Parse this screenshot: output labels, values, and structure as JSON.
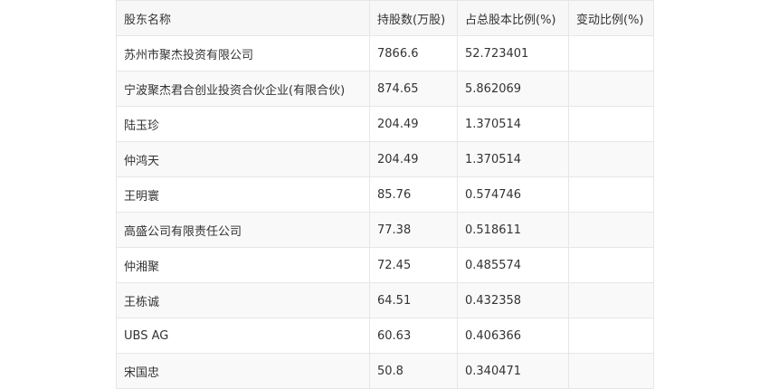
{
  "table": {
    "headers": [
      "股东名称",
      "持股数(万股)",
      "占总股本比例(%)",
      "变动比例(%)"
    ],
    "rows": [
      [
        "苏州市聚杰投资有限公司",
        "7866.6",
        "52.723401",
        ""
      ],
      [
        "宁波聚杰君合创业投资合伙企业(有限合伙)",
        "874.65",
        "5.862069",
        ""
      ],
      [
        "陆玉珍",
        "204.49",
        "1.370514",
        ""
      ],
      [
        "仲鸿天",
        "204.49",
        "1.370514",
        ""
      ],
      [
        "王明寰",
        "85.76",
        "0.574746",
        ""
      ],
      [
        "高盛公司有限责任公司",
        "77.38",
        "0.518611",
        ""
      ],
      [
        "仲湘聚",
        "72.45",
        "0.485574",
        ""
      ],
      [
        "王栋诚",
        "64.51",
        "0.432358",
        ""
      ],
      [
        "UBS AG",
        "60.63",
        "0.406366",
        ""
      ],
      [
        "宋国忠",
        "50.8",
        "0.340471",
        ""
      ]
    ]
  }
}
